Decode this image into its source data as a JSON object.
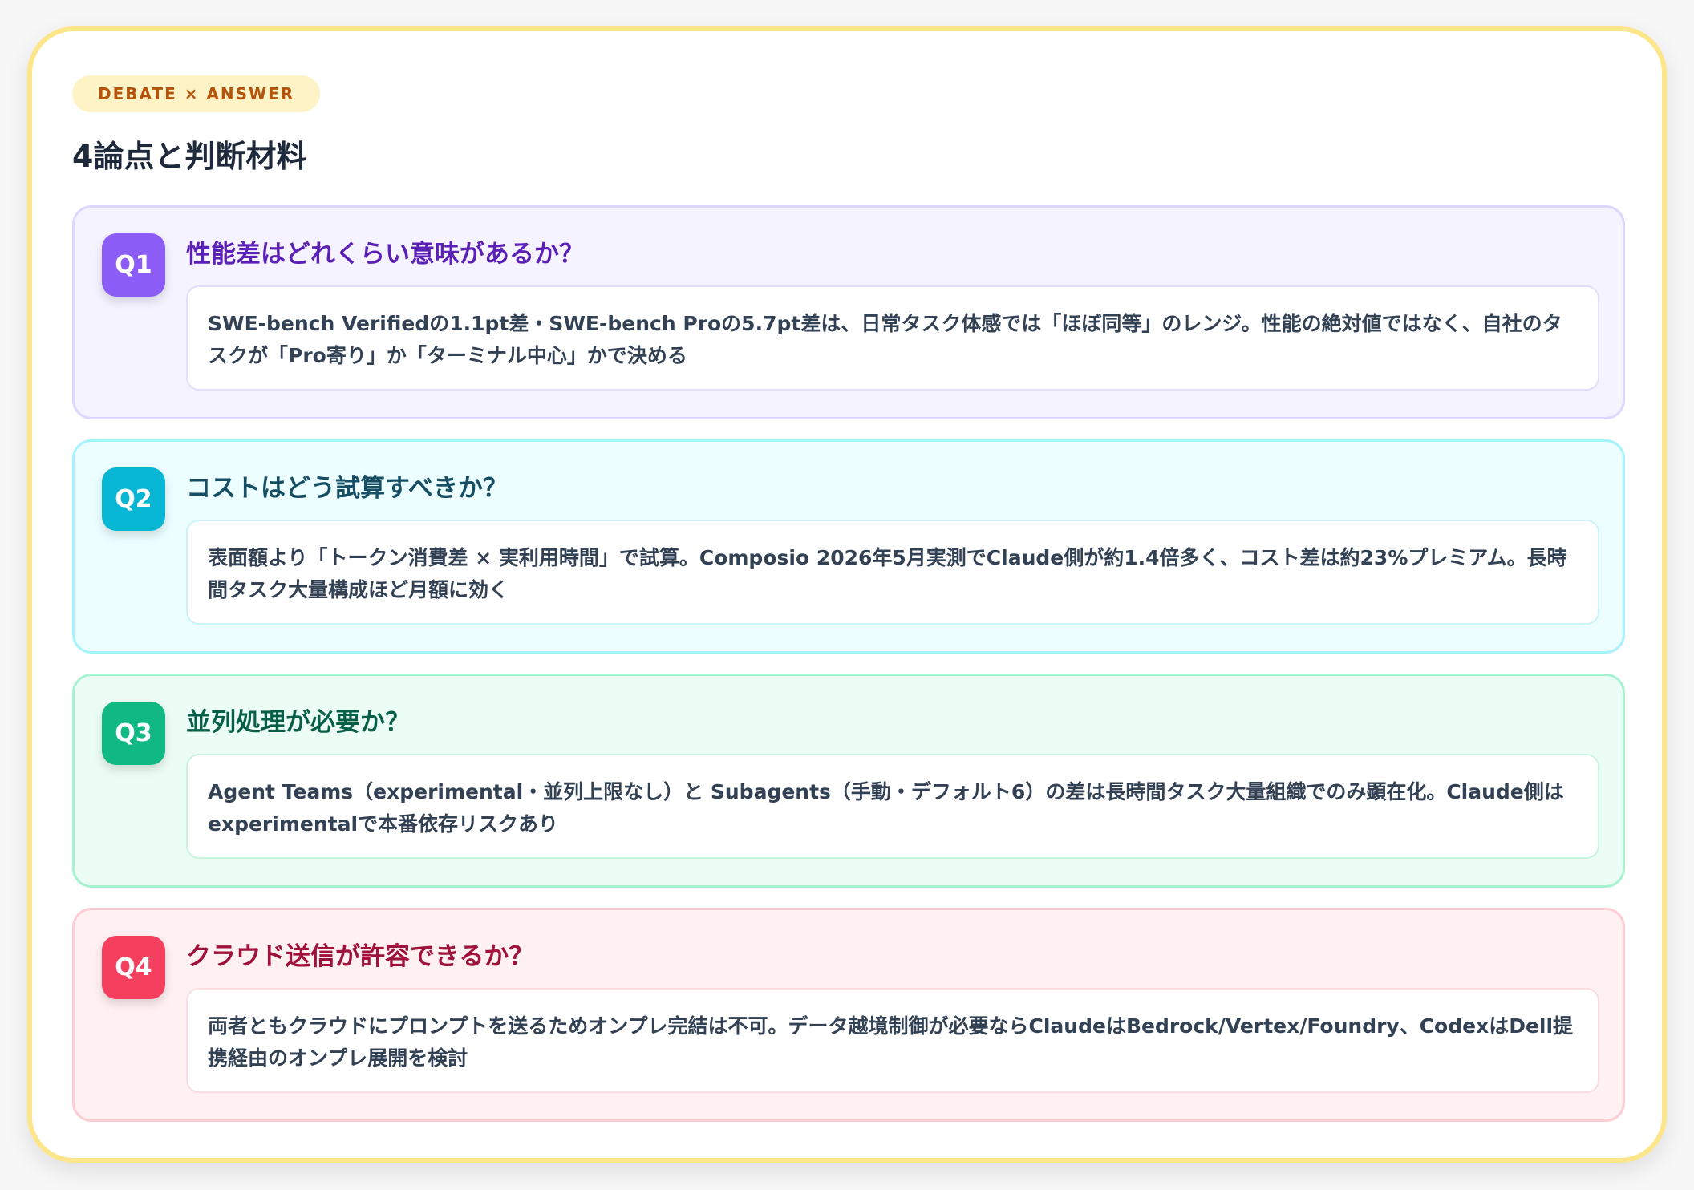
{
  "header": {
    "badge": "DEBATE × ANSWER",
    "title": "4論点と判断材料"
  },
  "colors": {
    "card_border": "#fde68a",
    "badge_bg": "#fef3c7",
    "badge_text": "#b45309",
    "q1_accent": "#8b5cf6",
    "q2_accent": "#06b6d4",
    "q3_accent": "#10b981",
    "q4_accent": "#f43f5e"
  },
  "questions": [
    {
      "id": "Q1",
      "heading": "性能差はどれくらい意味があるか？",
      "answer": "SWE-bench Verifiedの1.1pt差・SWE-bench Proの5.7pt差は、日常タスク体感では「ほぼ同等」のレンジ。性能の絶対値ではなく、自社のタスクが「Pro寄り」か「ターミナル中心」かで決める"
    },
    {
      "id": "Q2",
      "heading": "コストはどう試算すべきか？",
      "answer": "表面額より「トークン消費差 × 実利用時間」で試算。Composio 2026年5月実測でClaude側が約1.4倍多く、コスト差は約23%プレミアム。長時間タスク大量構成ほど月額に効く"
    },
    {
      "id": "Q3",
      "heading": "並列処理が必要か？",
      "answer": "Agent Teams（experimental・並列上限なし）と Subagents（手動・デフォルト6）の差は長時間タスク大量組織でのみ顕在化。Claude側はexperimentalで本番依存リスクあり"
    },
    {
      "id": "Q4",
      "heading": "クラウド送信が許容できるか？",
      "answer": "両者ともクラウドにプロンプトを送るためオンプレ完結は不可。データ越境制御が必要ならClaudeはBedrock/Vertex/Foundry、CodexはDell提携経由のオンプレ展開を検討"
    }
  ]
}
